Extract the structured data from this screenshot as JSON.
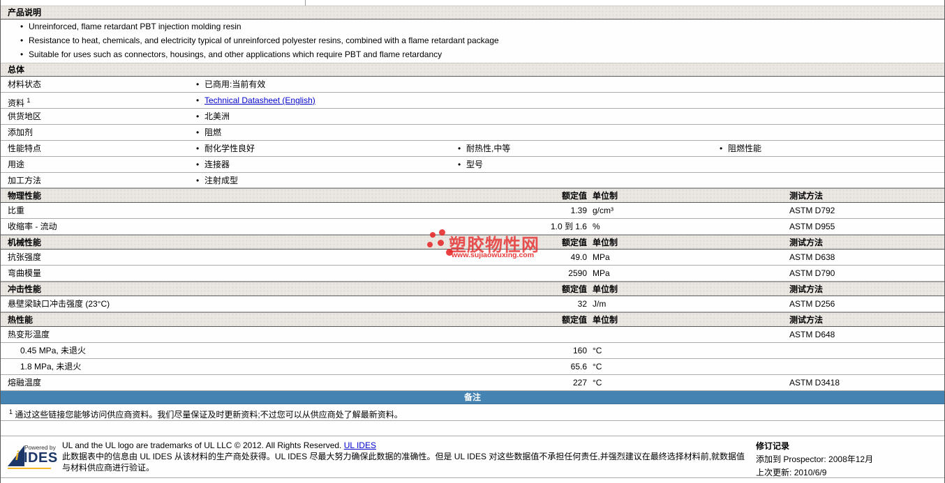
{
  "product_description": {
    "title": "产品说明",
    "bullets": [
      "Unreinforced, flame retardant PBT injection molding resin",
      "Resistance to heat, chemicals, and electricity typical of unreinforced polyester resins, combined with a flame retardant package",
      "Suitable for uses such as connectors, housings, and other applications which require PBT and flame retardancy"
    ]
  },
  "general": {
    "title": "总体",
    "rows": [
      {
        "label": "材料状态",
        "values": [
          "已商用:当前有效"
        ]
      },
      {
        "label": "资料",
        "sup": "1",
        "values": [
          "Technical Datasheet (English)"
        ]
      },
      {
        "label": "供货地区",
        "values": [
          "北美洲"
        ]
      },
      {
        "label": "添加剂",
        "values": [
          "阻燃"
        ]
      },
      {
        "label": "性能特点",
        "values": [
          "耐化学性良好",
          "耐热性,中等",
          "阻燃性能"
        ]
      },
      {
        "label": "用途",
        "values": [
          "连接器",
          "型号"
        ]
      },
      {
        "label": "加工方法",
        "values": [
          "注射成型"
        ]
      }
    ]
  },
  "props": {
    "headers": {
      "value": "额定值",
      "unit": "单位制",
      "method": "测试方法"
    },
    "sections": [
      {
        "title": "物理性能",
        "rows": [
          {
            "name": "比重",
            "value": "1.39",
            "unit": "g/cm³",
            "method": "ASTM D792"
          },
          {
            "name": "收缩率 - 流动",
            "value": "1.0 到  1.6",
            "unit": "%",
            "method": "ASTM D955"
          }
        ]
      },
      {
        "title": "机械性能",
        "rows": [
          {
            "name": "抗张强度",
            "value": "49.0",
            "unit": "MPa",
            "method": "ASTM D638"
          },
          {
            "name": "弯曲模量",
            "value": "2590",
            "unit": "MPa",
            "method": "ASTM D790"
          }
        ]
      },
      {
        "title": "冲击性能",
        "rows": [
          {
            "name": "悬壁梁缺口冲击强度  (23°C)",
            "value": "32",
            "unit": "J/m",
            "method": "ASTM D256"
          }
        ]
      },
      {
        "title": "热性能",
        "rows": [
          {
            "name": "热变形温度",
            "value": "",
            "unit": "",
            "method": "ASTM D648"
          },
          {
            "name": "0.45 MPa, 未退火",
            "value": "160",
            "unit": "°C",
            "method": ""
          },
          {
            "name": "1.8 MPa, 未退火",
            "value": "65.6",
            "unit": "°C",
            "method": ""
          },
          {
            "name": "熔融温度",
            "value": "227",
            "unit": "°C",
            "method": "ASTM D3418"
          }
        ]
      }
    ]
  },
  "notes": {
    "title": "备注",
    "footnote_sup": "1",
    "footnote": "通过这些链接您能够访问供应商资料。我们尽量保证及时更新资料;不过您可以从供应商处了解最新资料。"
  },
  "footer": {
    "logo": {
      "powered_by": "Powered by",
      "name": "IDES",
      "mark": "i"
    },
    "trademark_text": "UL and the UL logo are trademarks of UL LLC © 2012. All Rights Reserved. ",
    "trademark_link": "UL IDES",
    "disclaimer": "此数据表中的信息由  UL IDES 从该材料的生产商处获得。UL IDES 尽最大努力确保此数据的准确性。但是  UL IDES 对这些数据值不承担任何责任,并强烈建议在最终选择材料前,就数据值与材料供应商进行验证。",
    "revision": {
      "title": "修订记录",
      "added_label": "添加到  Prospector:",
      "added_value": "2008年12月",
      "updated_label": "上次更新:",
      "updated_value": "2010/6/9"
    }
  },
  "watermark": {
    "title": "塑胶物性网",
    "url": "www.sujiaowuxing.com"
  }
}
